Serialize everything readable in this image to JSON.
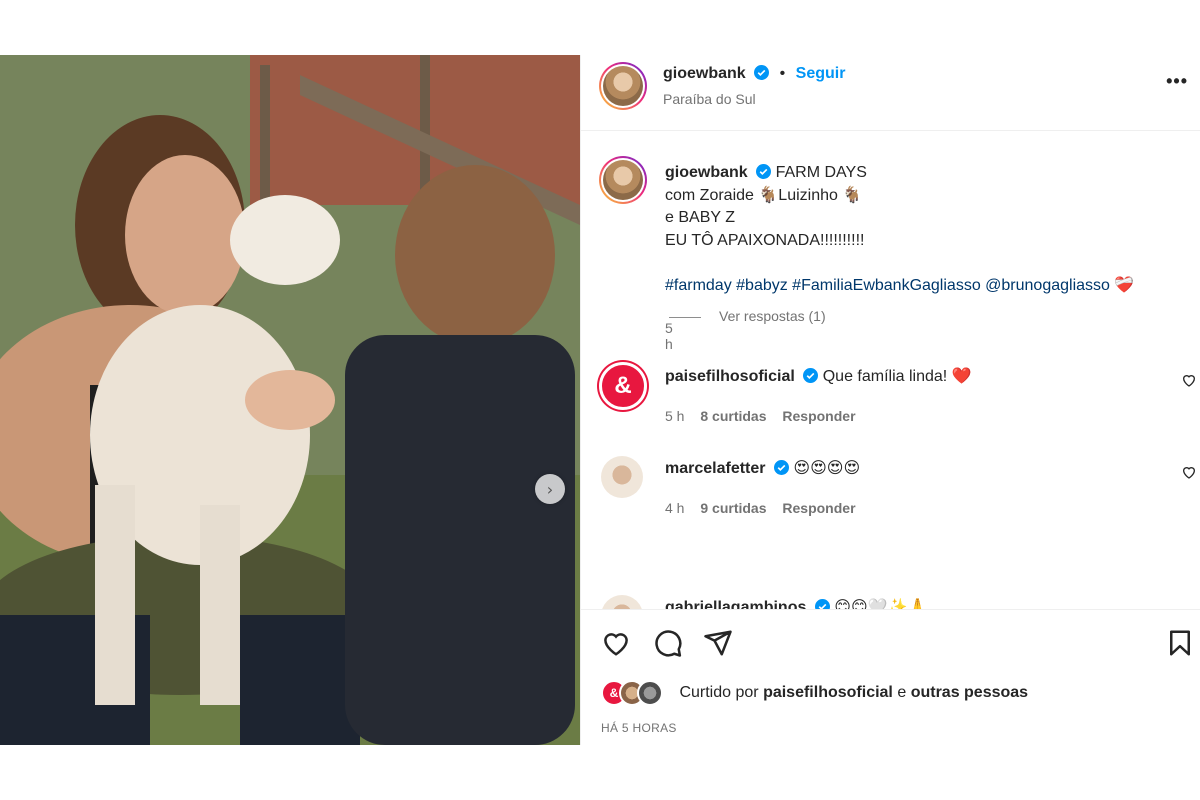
{
  "colors": {
    "accent": "#0095f6",
    "hashtag": "#00376b",
    "heart": "#ed4956",
    "muted": "#737373"
  },
  "photo": {
    "carousel_next_icon": "chevron-right-icon",
    "carousel_next_glyph": "›"
  },
  "header": {
    "username": "gioewbank",
    "separator": "•",
    "follow_label": "Seguir",
    "location": "Paraíba do Sul",
    "more_glyph": "•••"
  },
  "caption": {
    "username": "gioewbank",
    "lines": [
      "FARM DAYS",
      "com Zoraide 🐐Luizinho 🐐",
      "e BABY Z",
      "EU TÔ APAIXONADA!!!!!!!!!!"
    ],
    "hashtags": "#farmday #babyz #FamiliaEwbankGagliasso @brunogagliasso ❤️‍🩹",
    "time": "5 h"
  },
  "comments": [
    {
      "username": "paisefilhosoficial",
      "avatar_glyph": "&",
      "text": "Que família linda! ❤️",
      "time": "5 h",
      "likes": "8 curtidas",
      "reply": "Responder"
    },
    {
      "username": "marcelafetter",
      "text": "😍😍😍😍",
      "time": "4 h",
      "likes": "9 curtidas",
      "reply": "Responder",
      "view_replies": "Ver respostas (1)"
    },
    {
      "username": "gabriellagambinos",
      "text": "😊😊🤍✨🙏"
    }
  ],
  "actions": {
    "liked_prefix": "Curtido por",
    "liked_user": "paisefilhosoficial",
    "liked_conj": "e",
    "liked_others": "outras pessoas",
    "mini_avatar_glyph": "&",
    "time_ago": "HÁ 5 HORAS"
  }
}
